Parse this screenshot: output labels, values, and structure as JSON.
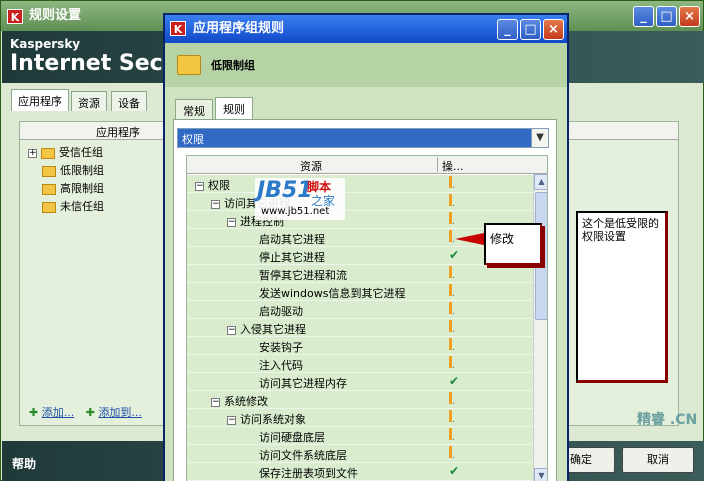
{
  "bg_window": {
    "title": "规则设置",
    "brand_line1": "Kaspersky",
    "brand_line2": "Internet Security 200",
    "tabs": [
      "应用程序",
      "资源",
      "设备"
    ],
    "column_header": "应用程序",
    "groups": [
      "受信任组",
      "低限制组",
      "高限制组",
      "未信任组"
    ],
    "add_link1": "添加...",
    "add_link2": "添加到...",
    "help": "帮助",
    "ok_label": "确定",
    "cancel_label": "取消",
    "watermark": "精睿 .CN"
  },
  "dialog": {
    "title": "应用程序组规则",
    "group_name": "低限制组",
    "tabs": [
      "常规",
      "规则"
    ],
    "combo_value": "权限",
    "table_headers": {
      "resource": "资源",
      "action": "操..."
    },
    "rows": [
      {
        "label": "权限",
        "level": 0,
        "expand": "−",
        "status": "warn"
      },
      {
        "label": "访问其它进程",
        "level": 1,
        "expand": "−",
        "status": "warn"
      },
      {
        "label": "进程控制",
        "level": 2,
        "expand": "−",
        "status": "warn"
      },
      {
        "label": "启动其它进程",
        "level": 3,
        "expand": "",
        "status": "warn"
      },
      {
        "label": "停止其它进程",
        "level": 3,
        "expand": "",
        "status": "check"
      },
      {
        "label": "暂停其它进程和流",
        "level": 3,
        "expand": "",
        "status": "warn"
      },
      {
        "label": "发送windows信息到其它进程",
        "level": 3,
        "expand": "",
        "status": "warn"
      },
      {
        "label": "启动驱动",
        "level": 3,
        "expand": "",
        "status": "warn"
      },
      {
        "label": "入侵其它进程",
        "level": 2,
        "expand": "−",
        "status": "warn"
      },
      {
        "label": "安装钩子",
        "level": 3,
        "expand": "",
        "status": "warn"
      },
      {
        "label": "注入代码",
        "level": 3,
        "expand": "",
        "status": "warn"
      },
      {
        "label": "访问其它进程内存",
        "level": 3,
        "expand": "",
        "status": "check"
      },
      {
        "label": "系统修改",
        "level": 1,
        "expand": "−",
        "status": "warn"
      },
      {
        "label": "访问系统对象",
        "level": 2,
        "expand": "−",
        "status": "warn"
      },
      {
        "label": "访问硬盘底层",
        "level": 3,
        "expand": "",
        "status": "warn"
      },
      {
        "label": "访问文件系统底层",
        "level": 3,
        "expand": "",
        "status": "warn"
      },
      {
        "label": "保存注册表项到文件",
        "level": 3,
        "expand": "",
        "status": "check"
      }
    ]
  },
  "logo": {
    "big": "JB51",
    "cn1": "脚本",
    "cn2": "之家",
    "url": "www.jb51.net"
  },
  "annotations": {
    "modify": "修改",
    "note": "这个是低受限的权限设置"
  },
  "icons": {
    "window_app": "K",
    "minimize": "_",
    "maximize": "□",
    "close": "×"
  }
}
